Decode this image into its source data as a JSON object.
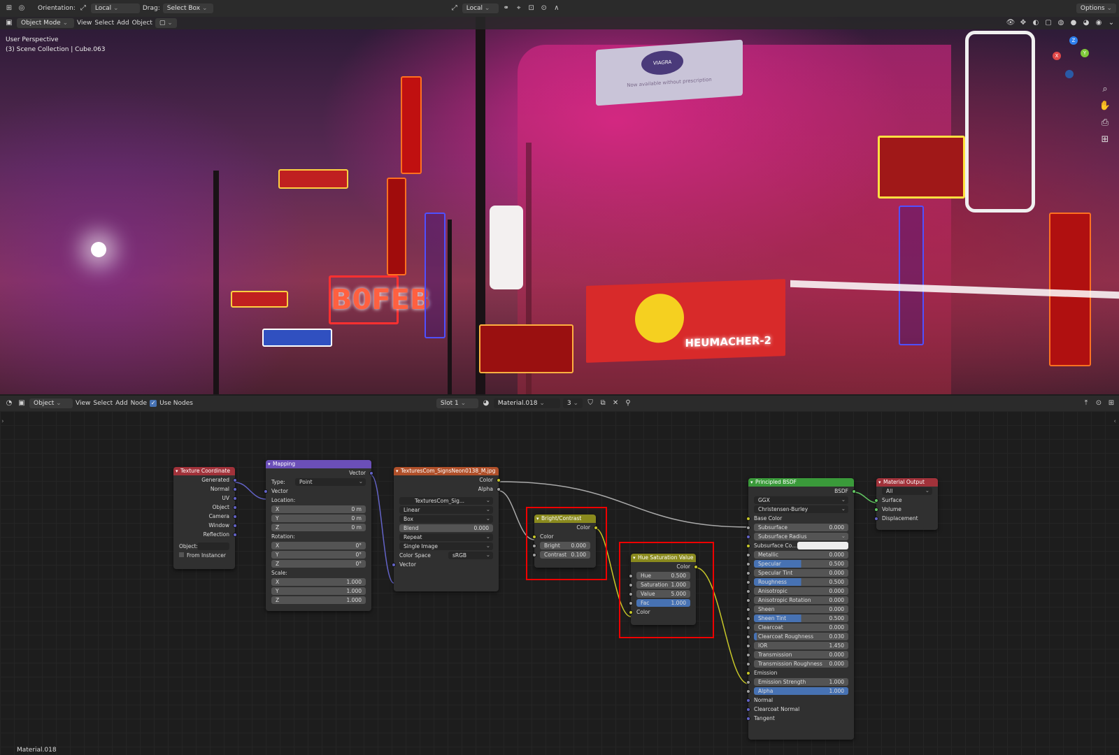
{
  "top_header": {
    "orientation_label": "Orientation:",
    "orientation_value": "Local",
    "drag_label": "Drag:",
    "drag_value": "Select Box",
    "pivot_value": "Local",
    "options_label": "Options"
  },
  "viewport_header": {
    "mode": "Object Mode",
    "menus": [
      "View",
      "Select",
      "Add",
      "Object"
    ]
  },
  "viewport": {
    "perspective": "User Perspective",
    "collection": "(3) Scene Collection | Cube.063",
    "signs": {
      "b0feb": "B0FEB",
      "heumacher": "HEUMACHER-2",
      "viagra": "VIAGRA",
      "viagra_sub": "Now available without prescription"
    }
  },
  "node_header": {
    "object_mode": "Object",
    "menus": [
      "View",
      "Select",
      "Add",
      "Node"
    ],
    "use_nodes_label": "Use Nodes",
    "slot": "Slot 1",
    "material": "Material.018",
    "users": "3"
  },
  "footer": {
    "material_name": "Material.018"
  },
  "nodes": {
    "texture_coordinate": {
      "title": "Texture Coordinate",
      "outputs": [
        "Generated",
        "Normal",
        "UV",
        "Object",
        "Camera",
        "Window",
        "Reflection"
      ],
      "object_label": "Object:",
      "from_instancer": "From Instancer"
    },
    "mapping": {
      "title": "Mapping",
      "output": "Vector",
      "type_label": "Type:",
      "type_value": "Point",
      "vector_input": "Vector",
      "location_label": "Location:",
      "location": [
        {
          "axis": "X",
          "value": "0 m"
        },
        {
          "axis": "Y",
          "value": "0 m"
        },
        {
          "axis": "Z",
          "value": "0 m"
        }
      ],
      "rotation_label": "Rotation:",
      "rotation": [
        {
          "axis": "X",
          "value": "0°"
        },
        {
          "axis": "Y",
          "value": "0°"
        },
        {
          "axis": "Z",
          "value": "0°"
        }
      ],
      "scale_label": "Scale:",
      "scale": [
        {
          "axis": "X",
          "value": "1.000"
        },
        {
          "axis": "Y",
          "value": "1.000"
        },
        {
          "axis": "Z",
          "value": "1.000"
        }
      ]
    },
    "image_texture": {
      "title": "TexturesCom_SignsNeon0138_M.jpg",
      "out_color": "Color",
      "out_alpha": "Alpha",
      "image_name": "TexturesCom_Sig...",
      "interpolation": "Linear",
      "projection": "Box",
      "blend_label": "Blend",
      "blend_value": "0.000",
      "extension": "Repeat",
      "source": "Single Image",
      "colorspace_label": "Color Space",
      "colorspace_value": "sRGB",
      "vector_input": "Vector"
    },
    "bright_contrast": {
      "title": "Bright/Contrast",
      "output": "Color",
      "input_color": "Color",
      "bright_label": "Bright",
      "bright_value": "0.000",
      "contrast_label": "Contrast",
      "contrast_value": "0.100"
    },
    "hue_sat": {
      "title": "Hue Saturation Value",
      "output": "Color",
      "hue_label": "Hue",
      "hue_value": "0.500",
      "sat_label": "Saturation",
      "sat_value": "1.000",
      "val_label": "Value",
      "val_value": "5.000",
      "fac_label": "Fac",
      "fac_value": "1.000",
      "input_color": "Color"
    },
    "principled": {
      "title": "Principled BSDF",
      "output": "BSDF",
      "distribution": "GGX",
      "subsurface_method": "Christensen-Burley",
      "base_color": "Base Color",
      "subsurface_label": "Subsurface",
      "subsurface_value": "0.000",
      "subsurface_radius": "Subsurface Radius",
      "subsurface_color": "Subsurface Co...",
      "params": [
        {
          "label": "Metallic",
          "value": "0.000",
          "fill": 0
        },
        {
          "label": "Specular",
          "value": "0.500",
          "fill": 0.5
        },
        {
          "label": "Specular Tint",
          "value": "0.000",
          "fill": 0
        },
        {
          "label": "Roughness",
          "value": "0.500",
          "fill": 0.5
        },
        {
          "label": "Anisotropic",
          "value": "0.000",
          "fill": 0
        },
        {
          "label": "Anisotropic Rotation",
          "value": "0.000",
          "fill": 0
        },
        {
          "label": "Sheen",
          "value": "0.000",
          "fill": 0
        },
        {
          "label": "Sheen Tint",
          "value": "0.500",
          "fill": 0.5
        },
        {
          "label": "Clearcoat",
          "value": "0.000",
          "fill": 0
        },
        {
          "label": "Clearcoat Roughness",
          "value": "0.030",
          "fill": 0.03
        },
        {
          "label": "IOR",
          "value": "1.450",
          "fill": 0
        },
        {
          "label": "Transmission",
          "value": "0.000",
          "fill": 0
        },
        {
          "label": "Transmission Roughness",
          "value": "0.000",
          "fill": 0
        }
      ],
      "emission": "Emission",
      "emission_strength_label": "Emission Strength",
      "emission_strength_value": "1.000",
      "alpha_label": "Alpha",
      "alpha_value": "1.000",
      "normal": "Normal",
      "clearcoat_normal": "Clearcoat Normal",
      "tangent": "Tangent"
    },
    "material_output": {
      "title": "Material Output",
      "target": "All",
      "surface": "Surface",
      "volume": "Volume",
      "displacement": "Displacement"
    }
  },
  "colors": {
    "input_header": "#a1323a",
    "vector_header": "#6b4fb8",
    "texture_header": "#b0502a",
    "color_header": "#8a8a1e",
    "shader_header": "#3a9a3a",
    "output_header": "#a1323a",
    "highlight": "#e00000"
  }
}
